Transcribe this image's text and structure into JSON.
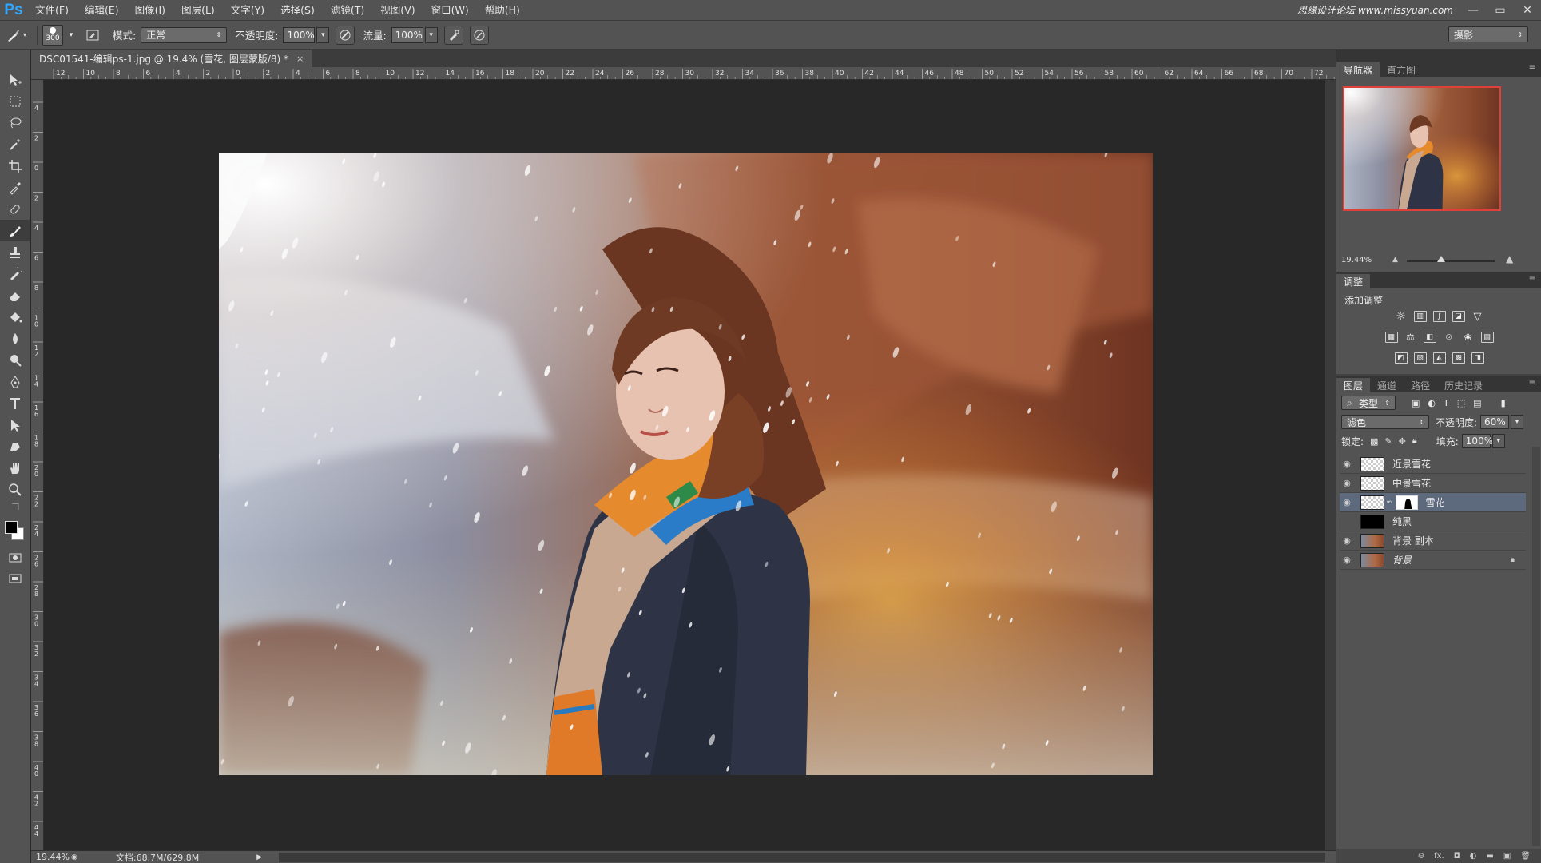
{
  "app": {
    "logo": "Ps",
    "watermark": "思缘设计论坛 www.missyuan.com"
  },
  "menu": [
    "文件(F)",
    "编辑(E)",
    "图像(I)",
    "图层(L)",
    "文字(Y)",
    "选择(S)",
    "滤镜(T)",
    "视图(V)",
    "窗口(W)",
    "帮助(H)"
  ],
  "window_controls": {
    "minimize": "—",
    "maximize": "▭",
    "close": "✕"
  },
  "options": {
    "brush_size": "300",
    "mode_label": "模式:",
    "mode_value": "正常",
    "opacity_label": "不透明度:",
    "opacity_value": "100%",
    "flow_label": "流量:",
    "flow_value": "100%",
    "workspace": "摄影"
  },
  "document": {
    "tab_title": "DSC01541-编辑ps-1.jpg @ 19.4% (雪花, 图层蒙版/8) *",
    "close": "×"
  },
  "ruler": {
    "top_labels": [
      "12",
      "10",
      "8",
      "6",
      "4",
      "2",
      "0",
      "2",
      "4",
      "6",
      "8",
      "10",
      "12",
      "14",
      "16",
      "18",
      "20",
      "22",
      "24",
      "26",
      "28",
      "30",
      "32",
      "34",
      "36",
      "38",
      "40",
      "42",
      "44",
      "46",
      "48",
      "50",
      "52",
      "54",
      "56",
      "58",
      "60",
      "62",
      "64",
      "66",
      "68",
      "70",
      "72",
      "74"
    ],
    "left_labels": [
      "4",
      "2",
      "0",
      "2",
      "4",
      "6",
      "8",
      "10",
      "12",
      "14",
      "16",
      "18",
      "20",
      "22",
      "24",
      "26",
      "28",
      "30",
      "32",
      "34",
      "36",
      "38",
      "40",
      "42",
      "44",
      "46"
    ]
  },
  "status": {
    "zoom": "19.44%",
    "doc_info": "文档:68.7M/629.8M"
  },
  "panels": {
    "navigator_tabs": [
      "导航器",
      "直方图"
    ],
    "navigator_zoom": "19.44%",
    "navigator_zoom_fraction": 0.194,
    "adjust_tab": "调整",
    "adjust_title": "添加调整",
    "layers_tabs": [
      "图层",
      "通道",
      "路径",
      "历史记录"
    ],
    "layer_filter": "类型",
    "blend_mode": "滤色",
    "opacity_label": "不透明度:",
    "opacity_value": "60%",
    "lock_label": "锁定:",
    "fill_label": "填充:",
    "fill_value": "100%"
  },
  "layers": [
    {
      "name": "近景雪花",
      "visible": true,
      "thumb": "checker"
    },
    {
      "name": "中景雪花",
      "visible": true,
      "thumb": "checker"
    },
    {
      "name": "雪花",
      "visible": true,
      "thumb": "checker",
      "mask": true,
      "selected": true
    },
    {
      "name": "纯黑",
      "visible": false,
      "thumb": "black"
    },
    {
      "name": "背景 副本",
      "visible": true,
      "thumb": "photo"
    },
    {
      "name": "背景",
      "visible": true,
      "thumb": "photo",
      "locked": true
    }
  ],
  "colors": {
    "accent": "#31a8ff",
    "selected_layer": "#5d6a7d",
    "nav_frame": "#e0403a"
  }
}
